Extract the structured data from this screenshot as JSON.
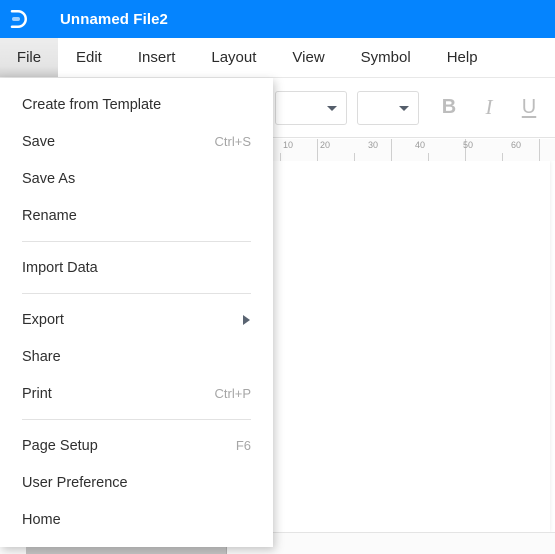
{
  "titlebar": {
    "app_icon": "edrawmax-logo-icon",
    "document_title": "Unnamed File2",
    "background_color": "#0584fe"
  },
  "menubar": {
    "tabs": [
      {
        "label": "File",
        "active": true
      },
      {
        "label": "Edit",
        "active": false
      },
      {
        "label": "Insert",
        "active": false
      },
      {
        "label": "Layout",
        "active": false
      },
      {
        "label": "View",
        "active": false
      },
      {
        "label": "Symbol",
        "active": false
      },
      {
        "label": "Help",
        "active": false
      }
    ]
  },
  "toolbar": {
    "font_family_select": {
      "value": "",
      "icon": "chevron-down-icon"
    },
    "font_size_select": {
      "value": "",
      "icon": "chevron-down-icon"
    },
    "bold_label": "B",
    "italic_label": "I",
    "underline_label": "U"
  },
  "ruler": {
    "unit_labels": [
      "10",
      "20",
      "30",
      "40",
      "50",
      "60"
    ],
    "orientation": "horizontal"
  },
  "file_menu": {
    "items": [
      {
        "type": "item",
        "label": "Create from Template",
        "shortcut": "",
        "submenu": false
      },
      {
        "type": "item",
        "label": "Save",
        "shortcut": "Ctrl+S",
        "submenu": false
      },
      {
        "type": "item",
        "label": "Save As",
        "shortcut": "",
        "submenu": false
      },
      {
        "type": "item",
        "label": "Rename",
        "shortcut": "",
        "submenu": false
      },
      {
        "type": "separator",
        "label": "",
        "shortcut": "",
        "submenu": false
      },
      {
        "type": "item",
        "label": "Import Data",
        "shortcut": "",
        "submenu": false
      },
      {
        "type": "separator",
        "label": "",
        "shortcut": "",
        "submenu": false
      },
      {
        "type": "item",
        "label": "Export",
        "shortcut": "",
        "submenu": true
      },
      {
        "type": "item",
        "label": "Share",
        "shortcut": "",
        "submenu": false
      },
      {
        "type": "item",
        "label": "Print",
        "shortcut": "Ctrl+P",
        "submenu": false
      },
      {
        "type": "separator",
        "label": "",
        "shortcut": "",
        "submenu": false
      },
      {
        "type": "item",
        "label": "Page Setup",
        "shortcut": "F6",
        "submenu": false
      },
      {
        "type": "item",
        "label": "User Preference",
        "shortcut": "",
        "submenu": false
      },
      {
        "type": "item",
        "label": "Home",
        "shortcut": "",
        "submenu": false
      }
    ]
  },
  "colors": {
    "accent": "#0584fe",
    "menu_active_bg": "#e4e4e4",
    "text": "#2f2f2f",
    "shortcut_text": "#a6a6a6",
    "canvas_bg": "#ffffff"
  }
}
